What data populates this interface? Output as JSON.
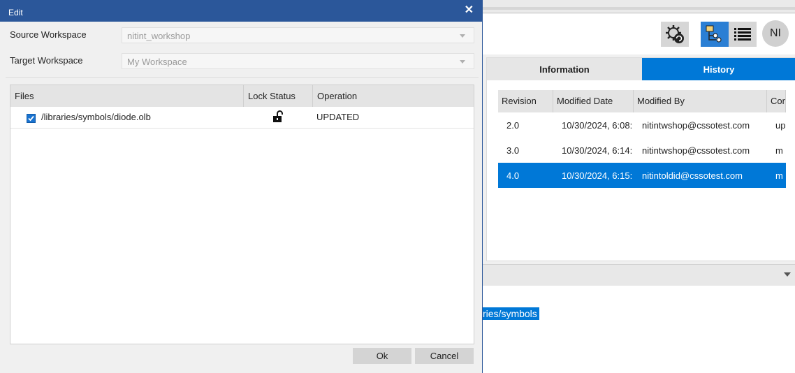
{
  "background_app": {
    "toolbar": {
      "gear_icon": "gear-refresh-icon",
      "tree_icon": "tree-view-icon",
      "list_icon": "list-view-icon",
      "avatar_initials": "NI"
    },
    "tabs": [
      {
        "label": "Information",
        "active": false
      },
      {
        "label": "History",
        "active": true
      }
    ],
    "history_table": {
      "columns": [
        "Revision",
        "Modified Date",
        "Modified By",
        "Cor"
      ],
      "rows": [
        {
          "revision": "2.0",
          "modified_date": "10/30/2024, 6:08:",
          "modified_by": "nitintwshop@cssotest.com",
          "comment": "up",
          "selected": false
        },
        {
          "revision": "3.0",
          "modified_date": "10/30/2024, 6:14:",
          "modified_by": "nitintwshop@cssotest.com",
          "comment": "m",
          "selected": false
        },
        {
          "revision": "4.0",
          "modified_date": "10/30/2024, 6:15:",
          "modified_by": "nitintoldid@cssotest.com",
          "comment": "m",
          "selected": true
        }
      ]
    },
    "path_text": "ries/symbols",
    "accent_color": "#0078d7"
  },
  "dialog": {
    "title": "Edit",
    "close_icon": "close-icon",
    "source_workspace_label": "Source Workspace",
    "source_workspace_value": "nitint_workshop",
    "target_workspace_label": "Target Workspace",
    "target_workspace_value": "My Workspace",
    "files_table": {
      "columns": [
        "Files",
        "Lock Status",
        "Operation"
      ],
      "rows": [
        {
          "checked": true,
          "file": "/libraries/symbols/diode.olb",
          "lock_status_icon": "unlocked-padlock-icon",
          "operation": "UPDATED"
        }
      ]
    },
    "ok_label": "Ok",
    "cancel_label": "Cancel",
    "title_bar_color": "#2b579a"
  }
}
